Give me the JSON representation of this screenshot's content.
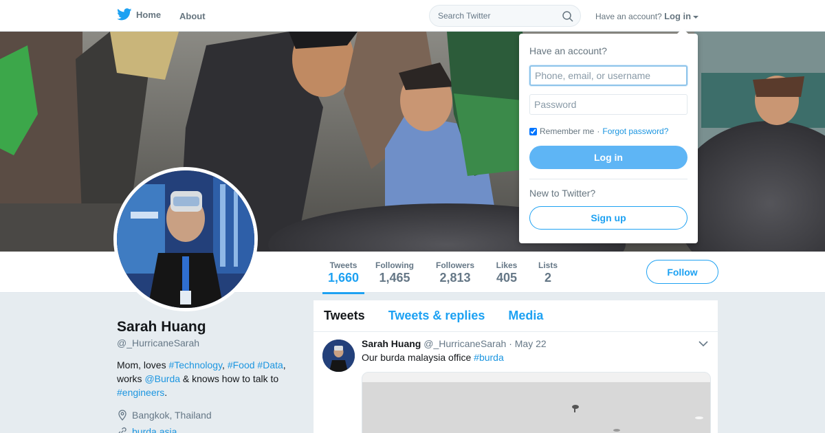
{
  "nav": {
    "home_label": "Home",
    "about_label": "About"
  },
  "search": {
    "placeholder": "Search Twitter"
  },
  "account": {
    "prompt": "Have an account?",
    "login_label": "Log in"
  },
  "login_dropdown": {
    "title": "Have an account?",
    "username_placeholder": "Phone, email, or username",
    "password_placeholder": "Password",
    "remember_label": "Remember me",
    "separator": "·",
    "forgot_label": "Forgot password?",
    "login_button": "Log in",
    "new_prompt": "New to Twitter?",
    "signup_button": "Sign up"
  },
  "stats": [
    {
      "label": "Tweets",
      "value": "1,660"
    },
    {
      "label": "Following",
      "value": "1,465"
    },
    {
      "label": "Followers",
      "value": "2,813"
    },
    {
      "label": "Likes",
      "value": "405"
    },
    {
      "label": "Lists",
      "value": "2"
    }
  ],
  "follow_button": "Follow",
  "profile": {
    "name": "Sarah Huang",
    "handle": "@_HurricaneSarah",
    "bio": {
      "p1": "Mom, loves ",
      "t1": "#Technology",
      "p2": ", ",
      "t2": "#Food",
      "p3": " ",
      "t3": "#Data",
      "p4": ", works ",
      "t4": "@Burda",
      "p5": " & knows how to talk to ",
      "t5": "#engineers",
      "p6": "."
    },
    "location": "Bangkok, Thailand",
    "website": "burda.asia"
  },
  "timeline": {
    "tabs": [
      {
        "label": "Tweets"
      },
      {
        "label": "Tweets & replies"
      },
      {
        "label": "Media"
      }
    ]
  },
  "tweet": {
    "name": "Sarah Huang",
    "handle": "@_HurricaneSarah",
    "dot": "·",
    "date": "May 22",
    "text": "Our burda malaysia office ",
    "hashtag": "#burda"
  },
  "colors": {
    "accent": "#1da1f2",
    "link": "#1b95e0",
    "muted": "#657786"
  },
  "icons": [
    "twitter-bird-icon",
    "search-icon",
    "caret-down-icon",
    "location-pin-icon",
    "link-icon",
    "chevron-down-icon"
  ]
}
